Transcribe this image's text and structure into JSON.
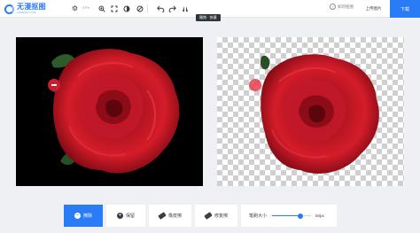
{
  "app": {
    "logo_title": "无漫抠图",
    "logo_subtitle": "AIMAKER.COM"
  },
  "toolbar": {
    "zoom_value": "37%",
    "tooltip": "撤销 · 快捷",
    "help_label": "如何抠图",
    "upload_label": "上传图片",
    "download_label": "下载"
  },
  "icons": {
    "gear": "gear-icon",
    "zoom_in": "zoom-in-icon",
    "fit": "fit-screen-icon",
    "compare": "compare-icon",
    "reset": "reset-icon",
    "undo": "undo-icon",
    "redo": "redo-icon",
    "flip": "flip-icon"
  },
  "bottom": {
    "erase_label": "擦除",
    "keep_label": "保留",
    "eraser_label": "橡皮擦",
    "repair_label": "修复擦",
    "brush_label": "笔刷大小",
    "brush_value_text": "50px",
    "brush_level": 0.72
  },
  "colors": {
    "accent": "#2a7bf6",
    "rose": "#cc1d2e",
    "canvas_bg": "#000000"
  }
}
